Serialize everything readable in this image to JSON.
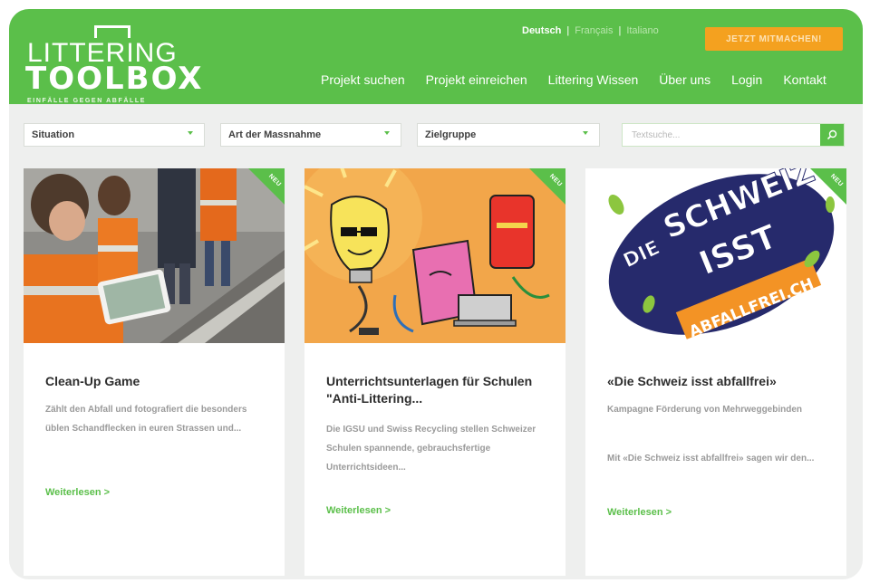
{
  "logo": {
    "line1": "LITTERING",
    "line2": "TOOLBOX",
    "tagline": "EINFÄLLE GEGEN ABFÄLLE"
  },
  "languages": {
    "active": "Deutsch",
    "separator": "|",
    "others": [
      "Français",
      "Italiano"
    ]
  },
  "cta_label": "JETZT MITMACHEN!",
  "nav": [
    "Projekt suchen",
    "Projekt einreichen",
    "Littering Wissen",
    "Über uns",
    "Login",
    "Kontakt"
  ],
  "filters": {
    "situation": "Situation",
    "massnahme": "Art der Massnahme",
    "zielgruppe": "Zielgruppe",
    "search_placeholder": "Textsuche..."
  },
  "cards": [
    {
      "badge": "NEU",
      "title": "Clean-Up Game",
      "description": [
        "Zählt den Abfall und fotografiert die besonders üblen Schandflecken in euren Strassen und..."
      ],
      "more": "Weiterlesen  >"
    },
    {
      "badge": "NEU",
      "title": "Unterrichtsunterlagen für Schulen \"Anti-Littering...",
      "description": [
        "Die IGSU und Swiss Recycling stellen Schweizer Schulen spannende, gebrauchsfertige Unterrichtsideen..."
      ],
      "more": "Weiterlesen  >"
    },
    {
      "badge": "NEU",
      "title": "«Die Schweiz isst abfallfrei»",
      "description": [
        "Kampagne Förderung von Mehrweggebinden",
        "Mit «Die Schweiz isst abfallfrei» sagen wir den..."
      ],
      "more": "Weiterlesen  >",
      "image_text": [
        "DIE",
        "SCHWEIZ",
        "ISST",
        "ABFALLFREI.CH"
      ]
    }
  ],
  "colors": {
    "brand_green": "#5bbf4a",
    "cta_orange": "#f4a11f",
    "background": "#eeefee"
  }
}
